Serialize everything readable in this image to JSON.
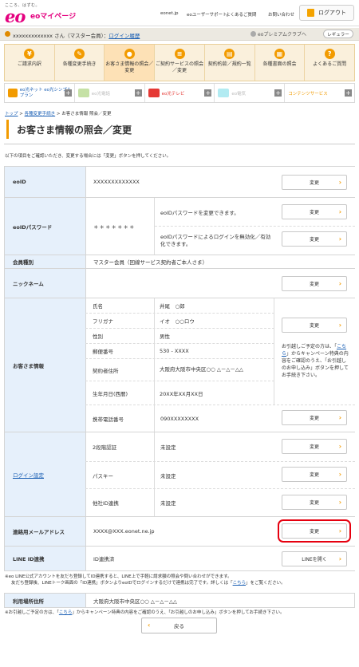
{
  "header": {
    "logo_tagline": "こころ、はずむ。",
    "logo_main": "eo",
    "app_title": "eoマイページ",
    "links": [
      "eonet.jp",
      "eoユーザーサポート",
      "よくあるご質問",
      "お問い合わせ"
    ],
    "logout_label": "ログアウト"
  },
  "user_bar": {
    "user_name": "xxxxxxxxxxxxx さん（マスター会員）",
    "login_history": "ログイン履歴",
    "premium_club": "eoプレミアムクラブへ",
    "member_rank": "レギュラー"
  },
  "menu": [
    {
      "label": "ご請求内訳",
      "icon": "yen-icon"
    },
    {
      "label": "各種変更手続き",
      "icon": "edit-icon"
    },
    {
      "label": "お客さま情報の照会／変更",
      "icon": "person-icon"
    },
    {
      "label": "ご契約サービスの照会／変更",
      "icon": "list-icon"
    },
    {
      "label": "契約約款／規約一覧",
      "icon": "book-icon"
    },
    {
      "label": "各種書面の照会",
      "icon": "document-icon"
    },
    {
      "label": "よくあるご質問",
      "icon": "question-icon"
    }
  ],
  "services": [
    {
      "label": "eo光ネット eo光シンプルプラン",
      "active": true,
      "color": "#f29b00"
    },
    {
      "label": "eo光電話",
      "active": false,
      "color": "#9ccc65"
    },
    {
      "label": "eo光テレビ",
      "active": true,
      "color": "#e53935"
    },
    {
      "label": "eo電気",
      "active": false,
      "color": "#80deea"
    },
    {
      "label": "コンテンツサービス",
      "active": true,
      "color": "#ffffff"
    }
  ],
  "breadcrumb": {
    "top": "トップ",
    "sep": ">",
    "procedures": "各種変更手続き",
    "current": "お客さま情報 照会／変更"
  },
  "page_title": "お客さま情報の照会／変更",
  "intro": "以下の項目をご確認いただき、変更する場合には「変更」ボタンを押してください。",
  "change_label": "変更",
  "line_open_label": "LINEを開く",
  "rows": {
    "eoid": {
      "label": "eoID",
      "value": "XXXXXXXXXXXXX"
    },
    "eoid_password": {
      "label": "eoIDパスワード",
      "value": "＊＊＊＊＊＊＊",
      "desc1": "eoIDパスワードを変更できます。",
      "desc2": "eoIDパスワードによるログインを無効化／有効化できます。"
    },
    "member_type": {
      "label": "会員種別",
      "value": "マスター会員（回線サービス契約者ご本人さま）"
    },
    "nickname": {
      "label": "ニックネーム",
      "value": ""
    },
    "customer_info": {
      "label": "お客さま情報",
      "items": [
        {
          "k": "氏名",
          "v": "井尾　○郎"
        },
        {
          "k": "フリガナ",
          "v": "イオ　○○ロウ"
        },
        {
          "k": "性別",
          "v": "男性"
        },
        {
          "k": "郵便番号",
          "v": "530 - XXXX"
        },
        {
          "k": "契約者住所",
          "v": "大阪府大阪市中央区○○ △－△－△△"
        },
        {
          "k": "生年月日(西暦)",
          "v": "20XX年XX月XX日"
        },
        {
          "k": "携帯電話番号",
          "v": "090XXXXXXXX"
        }
      ],
      "note_pre": "お引越しご予定の方は、「",
      "note_link": "こちら",
      "note_post": "」からキャンペーン特典の内容をご確認のうえ、「お引越しのお申し込み」ボタンを押してお手続き下さい。"
    },
    "login_settings": {
      "label": "ログイン設定",
      "items": [
        {
          "k": "2段階認証",
          "v": "未設定"
        },
        {
          "k": "パスキー",
          "v": "未設定"
        },
        {
          "k": "他社ID連携",
          "v": "未設定"
        }
      ]
    },
    "email": {
      "label": "連絡用メールアドレス",
      "value": "XXXX@XXX.eonet.ne.jp"
    },
    "line": {
      "label": "LINE ID連携",
      "value": "ID連携済"
    }
  },
  "line_note_1": "※eo LINE公式アカウントを友だち登録してID連携すると、LINE上で手軽に請求額の照会や問い合わせができます。",
  "line_note_2_pre": "友だち登録後、LINEトーク画面の「ID連携」ボタンよりeoIDでログインするだけで連携は完了です。詳しくは「",
  "line_note_2_link": "こちら",
  "line_note_2_post": "」をご覧ください。",
  "usage_place": {
    "label": "利用場所住所",
    "value": "大阪府大阪市中央区○○ △－△－△△"
  },
  "bottom_note_pre": "※お引越しご予定の方は、「",
  "bottom_note_link": "こちら",
  "bottom_note_post": "」からキャンペーン特典の内容をご確認のうえ、「お引越しのお申し込み」ボタンを押してお手続き下さい。",
  "back_label": "戻る"
}
